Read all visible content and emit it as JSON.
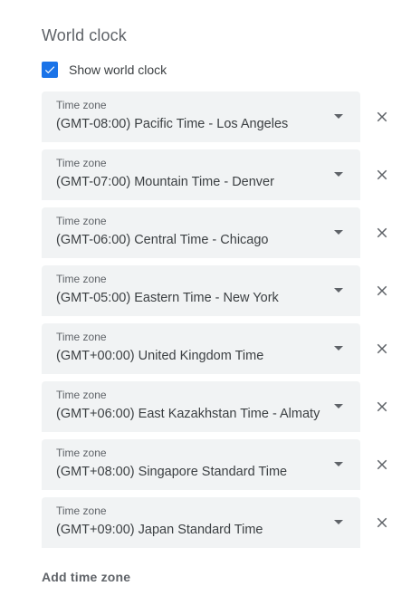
{
  "section": {
    "title": "World clock"
  },
  "show_world_clock": {
    "label": "Show world clock",
    "checked": true,
    "icon": "check-icon",
    "color": "#1a73e8"
  },
  "timezones": [
    {
      "label": "Time zone",
      "value": "(GMT-08:00) Pacific Time - Los Angeles"
    },
    {
      "label": "Time zone",
      "value": "(GMT-07:00) Mountain Time - Denver"
    },
    {
      "label": "Time zone",
      "value": "(GMT-06:00) Central Time - Chicago"
    },
    {
      "label": "Time zone",
      "value": "(GMT-05:00) Eastern Time - New York"
    },
    {
      "label": "Time zone",
      "value": "(GMT+00:00) United Kingdom Time"
    },
    {
      "label": "Time zone",
      "value": "(GMT+06:00) East Kazakhstan Time - Almaty"
    },
    {
      "label": "Time zone",
      "value": "(GMT+08:00) Singapore Standard Time"
    },
    {
      "label": "Time zone",
      "value": "(GMT+09:00) Japan Standard Time"
    }
  ],
  "icons": {
    "dropdown": "dropdown-arrow-icon",
    "remove": "close-icon"
  },
  "add_time_zone": {
    "label": "Add time zone"
  }
}
